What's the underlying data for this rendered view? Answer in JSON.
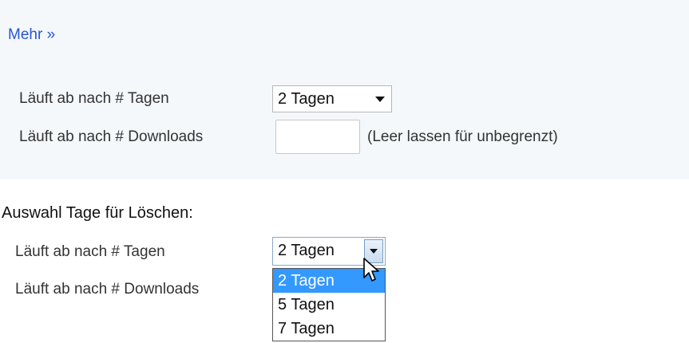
{
  "panel": {
    "more_link": "Mehr »",
    "expire_days_label": "Läuft ab nach # Tagen",
    "expire_days_selected": "2 Tagen",
    "expire_downloads_label": "Läuft ab nach # Downloads",
    "expire_downloads_value": "",
    "expire_downloads_hint": "(Leer lassen für unbegrenzt)"
  },
  "caption": "Auswahl Tage für Löschen:",
  "dropdown_demo": {
    "expire_days_label": "Läuft ab nach # Tagen",
    "expire_downloads_label": "Läuft ab nach # Downloads",
    "selected": "2 Tagen",
    "options": [
      "2 Tagen",
      "5 Tagen",
      "7 Tagen"
    ],
    "highlighted_index": 0
  },
  "icons": {
    "dropdown_arrow": "chevron-down-icon",
    "cursor": "mouse-pointer-icon"
  },
  "colors": {
    "panel_bg": "#f4f8fb",
    "link": "#2a54d6",
    "highlight": "#3399ff"
  }
}
